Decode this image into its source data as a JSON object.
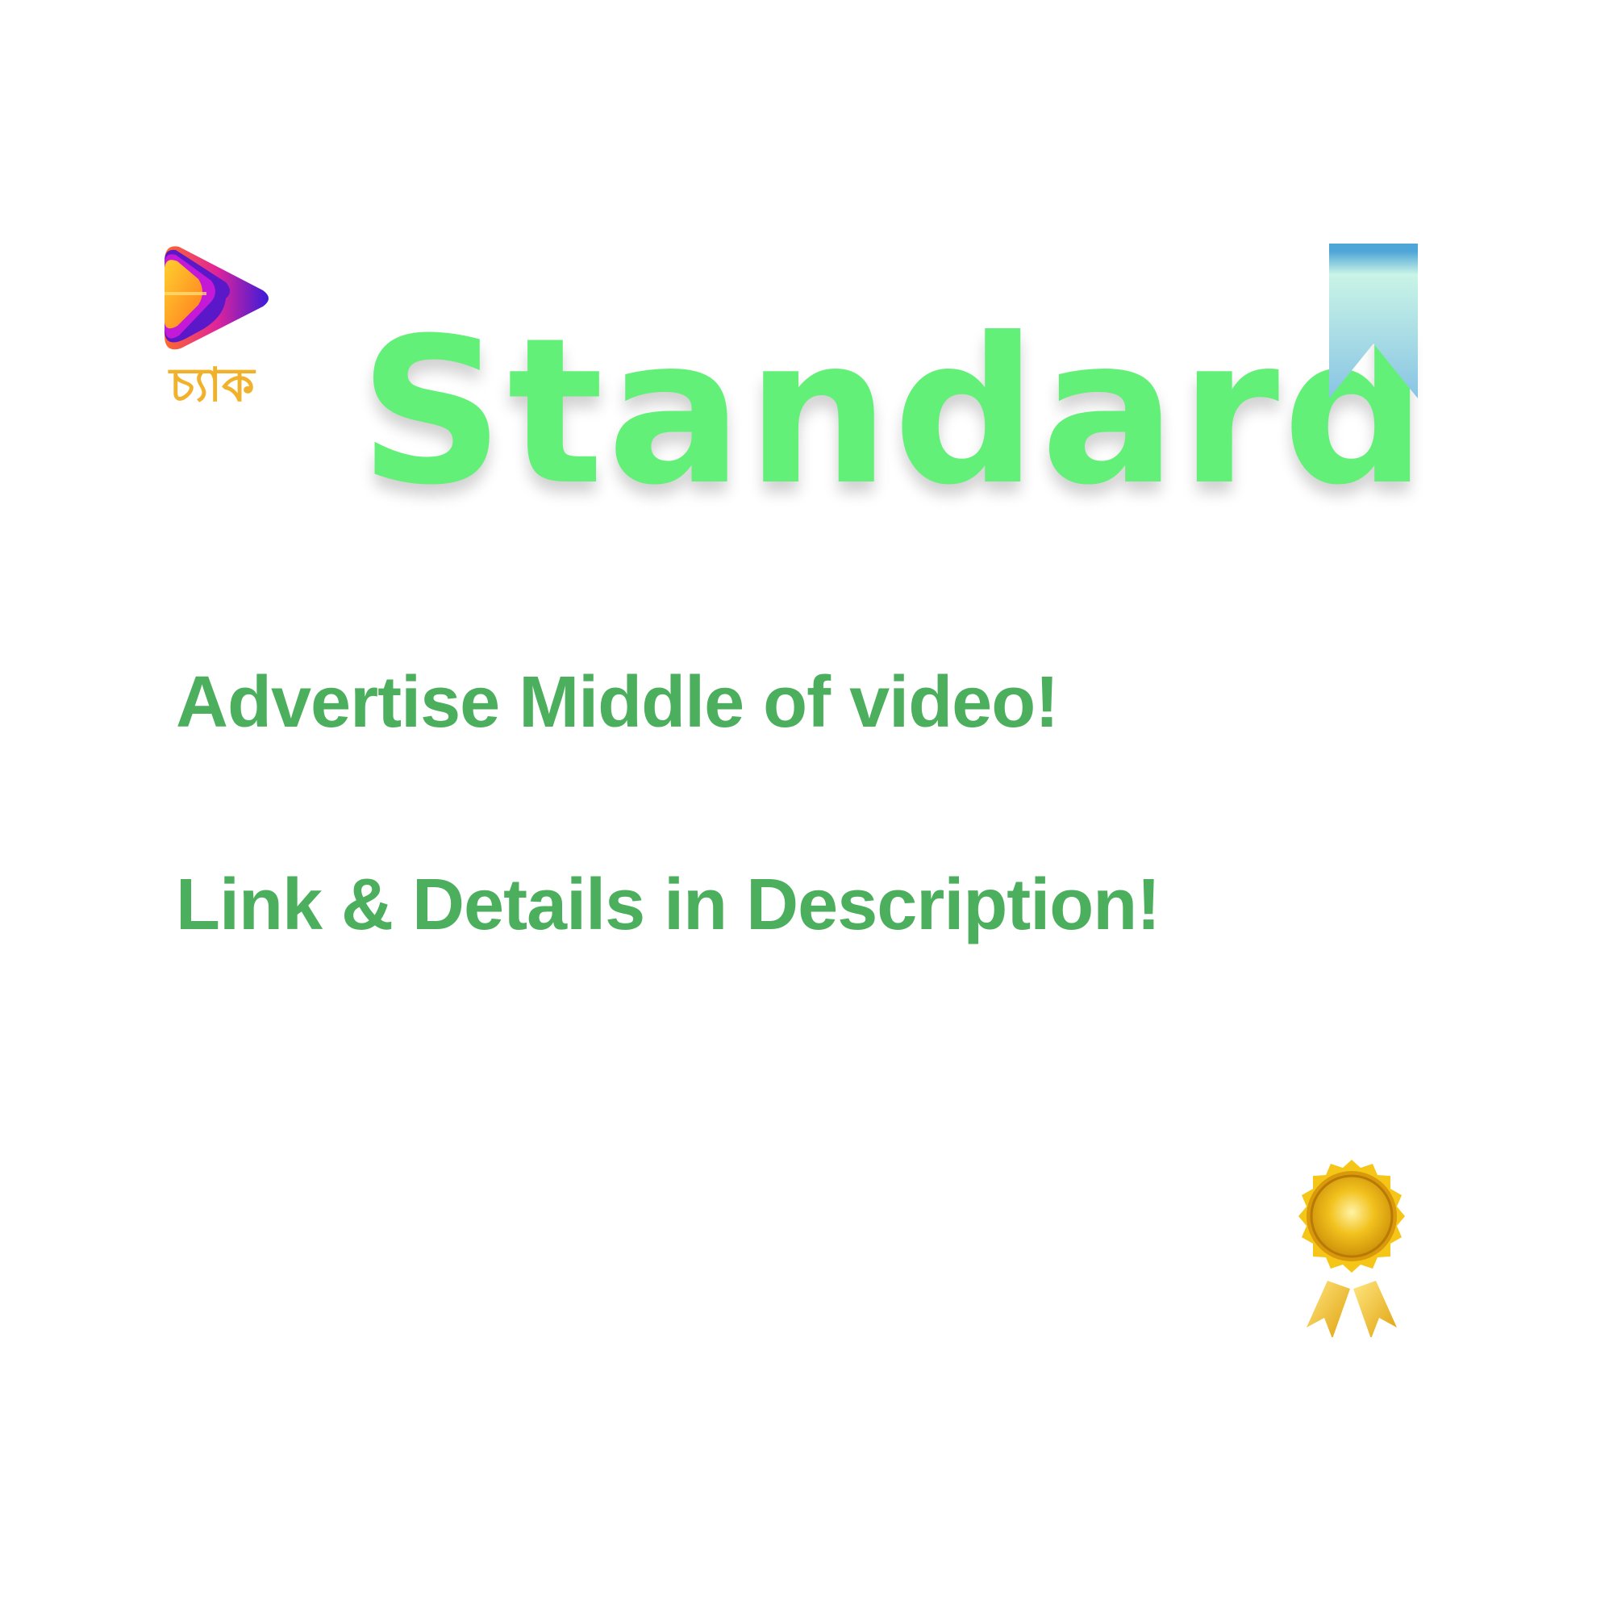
{
  "logo": {
    "icon": "play-icon",
    "text": "চ্যাক"
  },
  "title": "Standard",
  "lines": [
    "Advertise Middle of video!",
    "Link & Details in Description!"
  ],
  "decorations": {
    "bookmark": "bookmark-ribbon-icon",
    "award": "gold-award-badge-icon"
  },
  "colors": {
    "title": "#63f078",
    "body_text": "#4caf5d",
    "logo_text": "#f2b12a"
  }
}
